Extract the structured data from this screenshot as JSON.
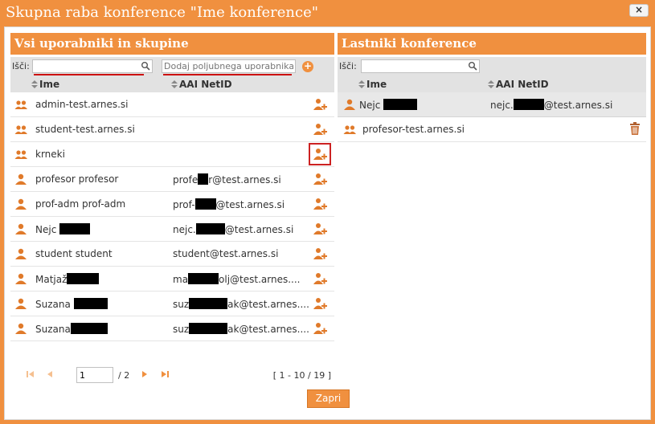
{
  "dialog": {
    "title": "Skupna raba konference \"Ime konference\"",
    "close_label": "×"
  },
  "left_panel": {
    "title": "Vsi uporabniki in skupine",
    "search_label": "Išči:",
    "search_value": "",
    "add_placeholder": "Dodaj poljubnega uporabnika",
    "columns": [
      "Ime",
      "AAI NetID"
    ],
    "rows": [
      {
        "type": "group",
        "name": "admin-test.arnes.si",
        "netid": ""
      },
      {
        "type": "group",
        "name": "student-test.arnes.si",
        "netid": ""
      },
      {
        "type": "group",
        "name": "krneki",
        "netid": ""
      },
      {
        "type": "user",
        "name": "profesor profesor",
        "netid_a": "profe",
        "netid_b": "r@test.arnes.si"
      },
      {
        "type": "user",
        "name": "prof-adm prof-adm",
        "netid_a": "prof-",
        "netid_b": "@test.arnes.si"
      },
      {
        "type": "user",
        "name": "Nejc ",
        "netid_a": "nejc.",
        "netid_b": "@test.arnes.si"
      },
      {
        "type": "user",
        "name": "student student",
        "netid_a": "student@test.arnes.si",
        "netid_b": ""
      },
      {
        "type": "user",
        "name": "Matjaž",
        "netid_a": "ma",
        "netid_b": "olj@test.arnes...."
      },
      {
        "type": "user",
        "name": "Suzana ",
        "netid_a": "suz",
        "netid_b": "ak@test.arnes...."
      },
      {
        "type": "user",
        "name": "Suzana",
        "netid_a": "suz",
        "netid_b": "ak@test.arnes...."
      }
    ],
    "pager": {
      "page": "1",
      "total": "/ 2",
      "range": "[ 1 - 10 / 19 ]"
    }
  },
  "right_panel": {
    "title": "Lastniki konference",
    "search_label": "Išči:",
    "search_value": "",
    "columns": [
      "Ime",
      "AAI NetID"
    ],
    "rows": [
      {
        "type": "user",
        "name": "Nejc ",
        "netid_a": "nejc.",
        "netid_b": "@test.arnes.si"
      },
      {
        "type": "group",
        "name": "profesor-test.arnes.si",
        "netid_a": "",
        "netid_b": ""
      }
    ]
  },
  "footer": {
    "close_label": "Zapri"
  },
  "colors": {
    "accent": "#f0903f",
    "header_gray": "#e2e2e2",
    "highlight_red": "#cc2222"
  }
}
